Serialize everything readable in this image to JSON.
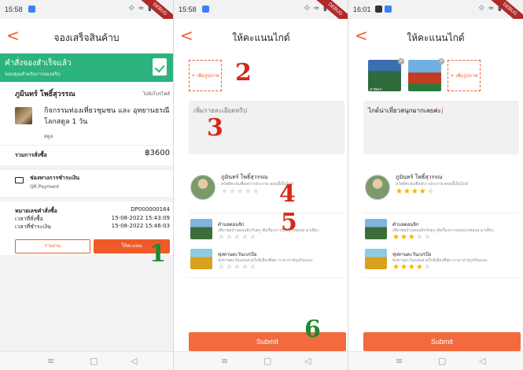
{
  "status_bar": {
    "time1": "15:58",
    "time2": "15:58",
    "time3": "16:01",
    "sys_icons": "⟐ ≈ ▮"
  },
  "debug_ribbon": "DEBUG",
  "screen1": {
    "title": "จองเสร็จสินค้าบ",
    "banner_title": "คำสั่งจองสำเร็จแล้ว",
    "banner_sub": "ขอบคุณสำหรับการจองทริป",
    "guide_name": "ภูมินทร์ โพธิ์สุวรรณ",
    "guide_link": "ไปยังโปรไฟล์",
    "product_name": "กิจกรรมท่องเที่ยวชุมชน และ อุทยานธรณีโลกสตูล 1 วัน",
    "product_location": "สตูล",
    "order_total_label": "รวมการสั่งซื้อ",
    "order_total_value": "฿3600",
    "payment_label": "ช่องทางการชำระเงิน",
    "payment_value": "QR Payment",
    "order_no_label": "หมายเลขคำสั่งซื้อ",
    "order_no_value": "DP000000164",
    "order_time_label": "เวลาที่สั่งซื้อ",
    "order_time_value": "15-08-2022 15:43:09",
    "paid_time_label": "เวลาที่ชำระเงิน",
    "paid_time_value": "15-08-2022 15:46:03",
    "report_btn": "รายงาน",
    "review_btn": "ให้คะแนน"
  },
  "screen2": {
    "title": "ให้คะแนนไกด์",
    "add_photo": "+ เพิ่มรูปภาพ",
    "textarea_placeholder": "เพิ่มรายละเอียดทริป",
    "guide_name": "ภูมินทร์ โพธิ์สุวรรณ",
    "guide_desc": "สวัสดีค่ะฉันชื่อพราวประกาย ตอนนี้เป็นไกด์",
    "trips": [
      {
        "name": "ตำบลดอนจิก",
        "desc": "เที่ยวชมบ้านดอนจิกกับครู ฟังเรื่องราวของบรรพบุรุษ มาเที่ยว"
      },
      {
        "name": "ทุ่งทานตะวันเบรบีอ",
        "desc": "ทุ่งทานตะวันแสนสวยใกล้เมืองที่สุด เรามาถ่ายรูปกันเถอะ"
      }
    ],
    "submit": "Submit"
  },
  "screen3": {
    "title": "ให้คะแนนไกด์",
    "add_photo": "+ เพิ่มรูปภาพ",
    "photo_caption": "ภาพแก",
    "textarea_value": "ไกด์น่าเที่ยวสนุกมากเลยค่ะ",
    "guide_name": "ภูมินทร์ โพธิ์สุวรรณ",
    "guide_desc": "สวัสดีค่ะฉันชื่อพราวประกาย ตอนนี้เป็นไกด์",
    "guide_rating": 4,
    "trips": [
      {
        "name": "ตำบลดอนจิก",
        "desc": "เที่ยวชมบ้านดอนจิกกับครู ฟังเรื่องราวของบรรพบุรุษ มาเที่ยว",
        "rating": 3
      },
      {
        "name": "ทุ่งทานตะวันเบรบีอ",
        "desc": "ทุ่งทานตะวันแสนสวยใกล้เมืองที่สุด เรามาถ่ายรูปกันเถอะ",
        "rating": 4
      }
    ],
    "submit": "Submit"
  },
  "annotations": {
    "a1": "1",
    "a2": "2",
    "a3": "3",
    "a4": "4",
    "a5": "5",
    "a6": "6"
  },
  "nav": {
    "menu": "≡",
    "home": "▢",
    "back": "◁"
  },
  "colors": {
    "accent": "#f05a28",
    "success": "#2db37d",
    "star": "#f5b301"
  }
}
